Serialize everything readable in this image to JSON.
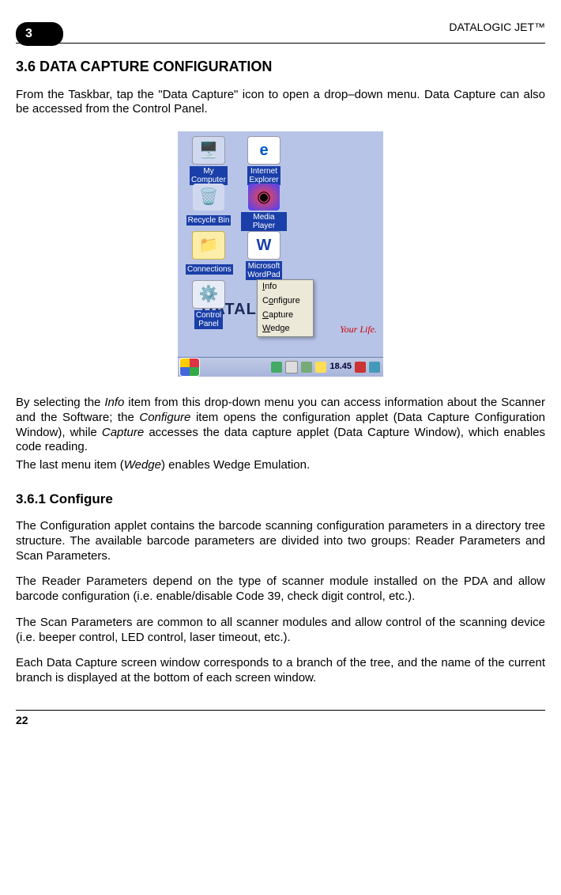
{
  "header": {
    "chapter_number": "3",
    "product_name": "DATALOGIC JET™"
  },
  "section": {
    "number_title": "3.6   DATA CAPTURE CONFIGURATION",
    "intro": "From the Taskbar, tap the \"Data Capture\" icon to open a drop–down menu. Data Capture can also be accessed from the Control Panel.",
    "para_after_shot_1": "By selecting the ",
    "para_after_shot_info": "Info",
    "para_after_shot_2": " item from this drop-down menu you can access information about the Scanner and the Software; the ",
    "para_after_shot_configure": "Configure",
    "para_after_shot_3": " item opens the configuration applet (Data Capture Configuration Window), while ",
    "para_after_shot_capture": "Capture",
    "para_after_shot_4": " accesses the data capture applet (Data Capture Window), which enables code reading.",
    "para_after_shot_5": "The last menu item (",
    "para_after_shot_wedge": "Wedge",
    "para_after_shot_6": ") enables Wedge Emulation."
  },
  "subsection": {
    "number_title": "3.6.1     Configure",
    "p1": "The Configuration applet contains the barcode scanning configuration parameters in a directory tree structure. The available barcode parameters are divided into two groups: Reader Parameters and Scan Parameters.",
    "p2": "The Reader Parameters depend on the type of scanner module installed on the PDA and allow barcode configuration (i.e. enable/disable Code 39, check digit control, etc.).",
    "p3": "The Scan Parameters are common to all scanner modules and allow control of the scanning device (i.e. beeper control, LED control, laser timeout, etc.).",
    "p4": "Each Data Capture screen window corresponds to a branch of the tree, and the name of the current branch is displayed at the bottom of each screen window."
  },
  "screenshot": {
    "icons": [
      {
        "label": "My\nComputer"
      },
      {
        "label": "Internet\nExplorer"
      },
      {
        "label": "Recycle Bin"
      },
      {
        "label": "Media Player"
      },
      {
        "label": "Connections"
      },
      {
        "label": "Microsoft\nWordPad"
      },
      {
        "label": "Control\nPanel"
      }
    ],
    "menu_items": [
      "Info",
      "Configure",
      "Capture",
      "Wedge"
    ],
    "brand": "DATALOGIC",
    "tagline": "Your Life.",
    "clock": "18.45"
  },
  "footer": {
    "page_number": "22"
  }
}
